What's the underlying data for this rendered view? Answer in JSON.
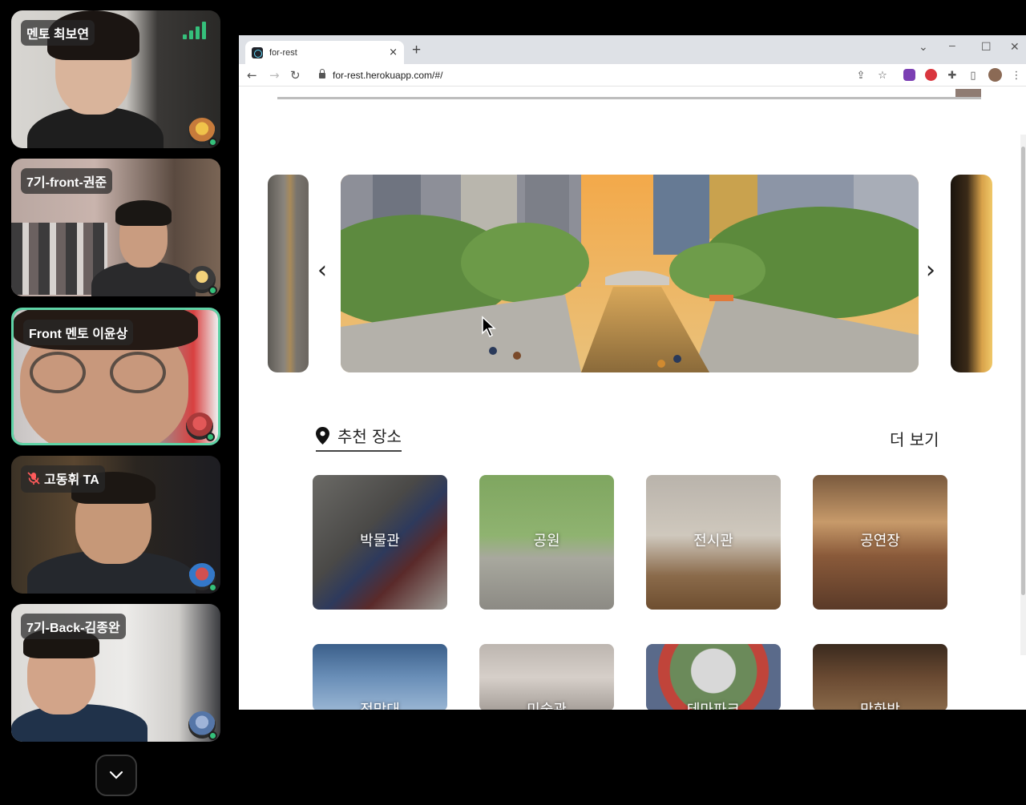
{
  "participants": [
    {
      "name": "멘토 최보연",
      "muted": false,
      "speaking": false,
      "signal": true
    },
    {
      "name": "7기-front-권준",
      "muted": false,
      "speaking": false
    },
    {
      "name": "Front 멘토 이윤상",
      "muted": false,
      "speaking": true
    },
    {
      "name": "고동휘 TA",
      "muted": true,
      "speaking": false
    },
    {
      "name": "7기-Back-김종완",
      "muted": false,
      "speaking": false
    }
  ],
  "browser": {
    "tab_title": "for-rest",
    "url": "for-rest.herokuapp.com/#/",
    "new_tab": "+",
    "close_tab": "×"
  },
  "page": {
    "section_title": "추천 장소",
    "more_label": "더 보기",
    "carousel_prev": "‹",
    "carousel_next": "›",
    "categories": [
      "박물관",
      "공원",
      "전시관",
      "공연장",
      "전망대",
      "미술관",
      "테마파크",
      "만화방"
    ]
  },
  "colors": {
    "active_border": "#5fd3a6",
    "status_online": "#35c07b"
  }
}
